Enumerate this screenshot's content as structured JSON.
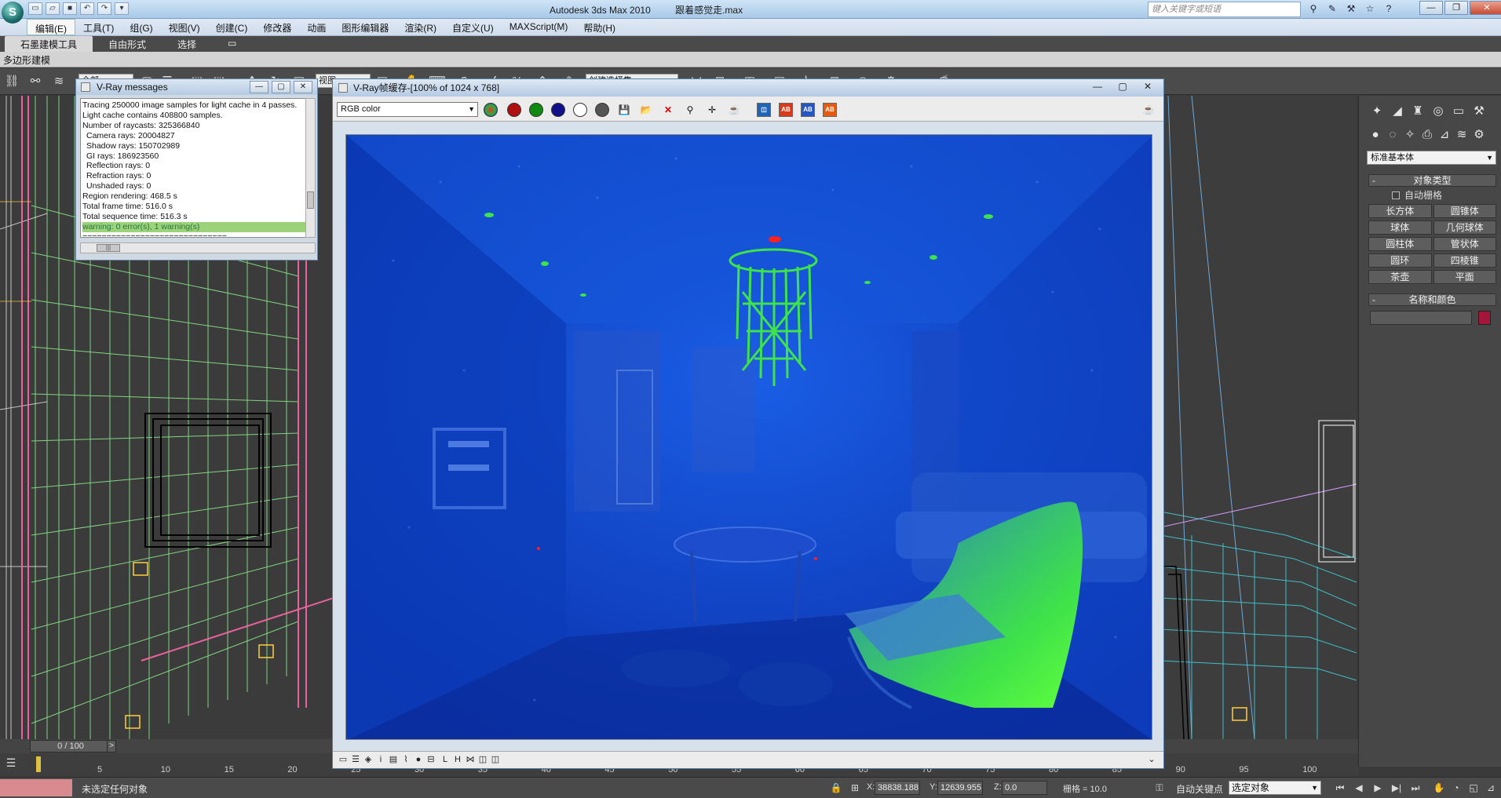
{
  "title_bar": {
    "app_name": "Autodesk 3ds Max  2010",
    "file_name": "跟着感觉走.max",
    "search_placeholder": "键入关键字或短语",
    "logo_glyph": "S",
    "quick_access_icons": [
      "new-file-icon",
      "open-folder-icon",
      "save-icon",
      "undo-icon",
      "redo-icon",
      "dropdown-icon"
    ],
    "help_icons": [
      "binoculars-icon",
      "tools-icon",
      "wrench-icon",
      "star-icon",
      "help-icon"
    ]
  },
  "menu": {
    "items": [
      "编辑(E)",
      "工具(T)",
      "组(G)",
      "视图(V)",
      "创建(C)",
      "修改器",
      "动画",
      "图形编辑器",
      "渲染(R)",
      "自定义(U)",
      "MAXScript(M)",
      "帮助(H)"
    ]
  },
  "ribbon": {
    "tabs": [
      "石墨建模工具",
      "自由形式",
      "选择"
    ],
    "sub_panel": "多边形建模"
  },
  "main_toolbar": {
    "selection_filter": "全部",
    "reference_coord": "视图",
    "named_selection": "创建选择集"
  },
  "vray_messages": {
    "title": "V-Ray messages",
    "lines": [
      "Tracing 250000 image samples for light cache in 4 passes.",
      "Light cache contains 408800 samples.",
      "Number of raycasts: 325366840",
      "Camera rays: 20004827",
      "Shadow rays: 150702989",
      "GI rays: 186923560",
      "Reflection rays: 0",
      "Refraction rays: 0",
      "Unshaded rays: 0",
      "Region rendering: 468.5 s",
      "Total frame time: 516.0 s",
      "Total sequence time: 516.3 s",
      "warning: 0 error(s), 1 warning(s)",
      "=============================="
    ]
  },
  "vfb": {
    "title": "V-Ray帧缓存-[100% of 1024 x 768]",
    "channel": "RGB color",
    "colors": {
      "render_bg": "#0c3fc0",
      "highlight_green": "#3ee24a",
      "red_dot": "#ff2020"
    }
  },
  "command_panel": {
    "category": "标准基本体",
    "object_type_header": "对象类型",
    "autogrid_label": "自动栅格",
    "buttons": [
      "长方体",
      "圆锥体",
      "球体",
      "几何球体",
      "圆柱体",
      "管状体",
      "圆环",
      "四棱锥",
      "茶壶",
      "平面"
    ],
    "name_color_header": "名称和颜色",
    "object_color": "#a3163a"
  },
  "timeline": {
    "frame_display": "0 / 100",
    "ticks": [
      "5",
      "10",
      "15",
      "20",
      "25",
      "30",
      "35",
      "40",
      "45",
      "50",
      "55",
      "60",
      "65",
      "70",
      "75",
      "80",
      "85",
      "90",
      "95",
      "100"
    ]
  },
  "status_bar": {
    "prompt": "未选定任何对象",
    "x_label": "X:",
    "x_value": "38838.188",
    "y_label": "Y:",
    "y_value": "12639.955",
    "z_label": "Z:",
    "z_value": "0.0",
    "grid": "栅格 = 10.0",
    "auto_key": "自动关键点",
    "selection_mode": "选定对象"
  }
}
